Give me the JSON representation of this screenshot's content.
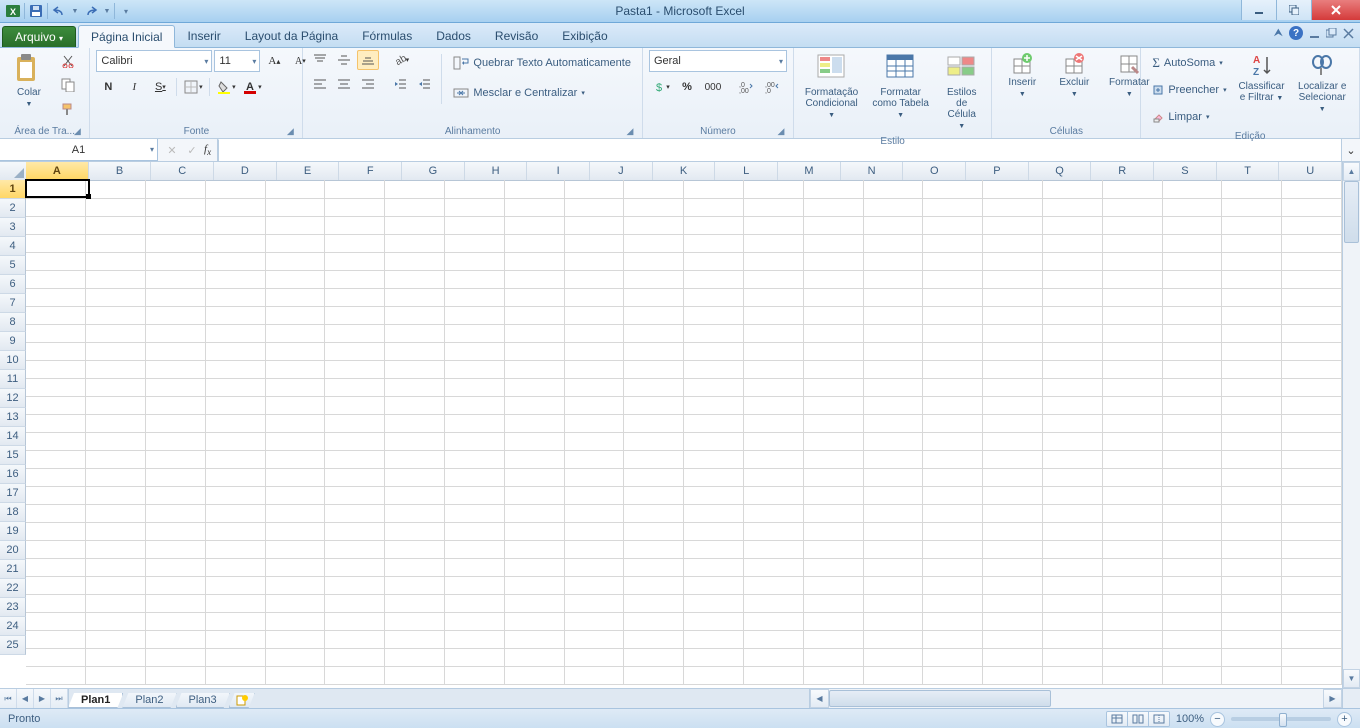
{
  "title": "Pasta1 - Microsoft Excel",
  "tabs": {
    "file": "Arquivo",
    "list": [
      "Página Inicial",
      "Inserir",
      "Layout da Página",
      "Fórmulas",
      "Dados",
      "Revisão",
      "Exibição"
    ],
    "activeIndex": 0
  },
  "ribbon": {
    "clipboard": {
      "label": "Área de Tra...",
      "paste": "Colar"
    },
    "font": {
      "label": "Fonte",
      "name": "Calibri",
      "size": "11"
    },
    "alignment": {
      "label": "Alinhamento",
      "wrap": "Quebrar Texto Automaticamente",
      "merge": "Mesclar e Centralizar"
    },
    "number": {
      "label": "Número",
      "format": "Geral"
    },
    "styles": {
      "label": "Estilo",
      "cond": "Formatação",
      "cond2": "Condicional",
      "table": "Formatar",
      "table2": "como Tabela",
      "cell": "Estilos de",
      "cell2": "Célula"
    },
    "cells": {
      "label": "Células",
      "insert": "Inserir",
      "delete": "Excluir",
      "format": "Formatar"
    },
    "editing": {
      "label": "Edição",
      "autosum": "AutoSoma",
      "fill": "Preencher",
      "clear": "Limpar",
      "sort": "Classificar",
      "sort2": "e Filtrar",
      "find": "Localizar e",
      "find2": "Selecionar"
    }
  },
  "namebox": "A1",
  "columns": [
    "A",
    "B",
    "C",
    "D",
    "E",
    "F",
    "G",
    "H",
    "I",
    "J",
    "K",
    "L",
    "M",
    "N",
    "O",
    "P",
    "Q",
    "R",
    "S",
    "T",
    "U"
  ],
  "rowCount": 25,
  "activeCell": {
    "row": 0,
    "col": 0
  },
  "sheetTabs": [
    "Plan1",
    "Plan2",
    "Plan3"
  ],
  "activeSheet": 0,
  "status": {
    "ready": "Pronto",
    "zoom": "100%"
  }
}
